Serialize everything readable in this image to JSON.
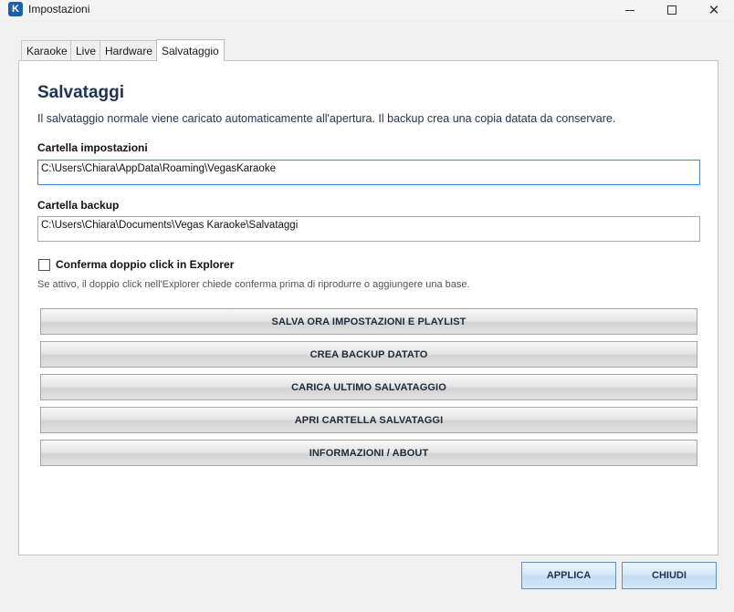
{
  "window": {
    "title": "Impostazioni",
    "icon": "karaoke-app-icon",
    "icon_glyph": "K"
  },
  "tabs": [
    {
      "label": "Karaoke"
    },
    {
      "label": "Live"
    },
    {
      "label": "Hardware"
    },
    {
      "label": "Salvataggio",
      "active": true
    }
  ],
  "content": {
    "heading": "Salvataggi",
    "description": "Il salvataggio normale viene caricato automaticamente all'apertura. Il backup crea una copia datata da conservare.",
    "settings_folder": {
      "label": "Cartella impostazioni",
      "value": "C:\\Users\\Chiara\\AppData\\Roaming\\VegasKaraoke"
    },
    "backup_folder": {
      "label": "Cartella backup",
      "value": "C:\\Users\\Chiara\\Documents\\Vegas Karaoke\\Salvataggi"
    },
    "confirm_double_click": {
      "label": "Conferma doppio click in Explorer",
      "checked": false,
      "hint": "Se attivo, il doppio click nell'Explorer chiede conferma prima di riprodurre o aggiungere una base."
    },
    "actions": [
      {
        "label": "SALVA ORA IMPOSTAZIONI E PLAYLIST"
      },
      {
        "label": "CREA BACKUP DATATO"
      },
      {
        "label": "CARICA ULTIMO SALVATAGGIO"
      },
      {
        "label": "APRI CARTELLA SALVATAGGI"
      },
      {
        "label": "INFORMAZIONI / ABOUT"
      }
    ]
  },
  "footer": {
    "apply_label": "APPLICA",
    "close_label": "CHIUDI"
  },
  "colors": {
    "heading": "#1f3350",
    "panel_bg": "#ffffff",
    "window_bg": "#f0f0f0",
    "footer_button_border": "#5f8fc0"
  }
}
